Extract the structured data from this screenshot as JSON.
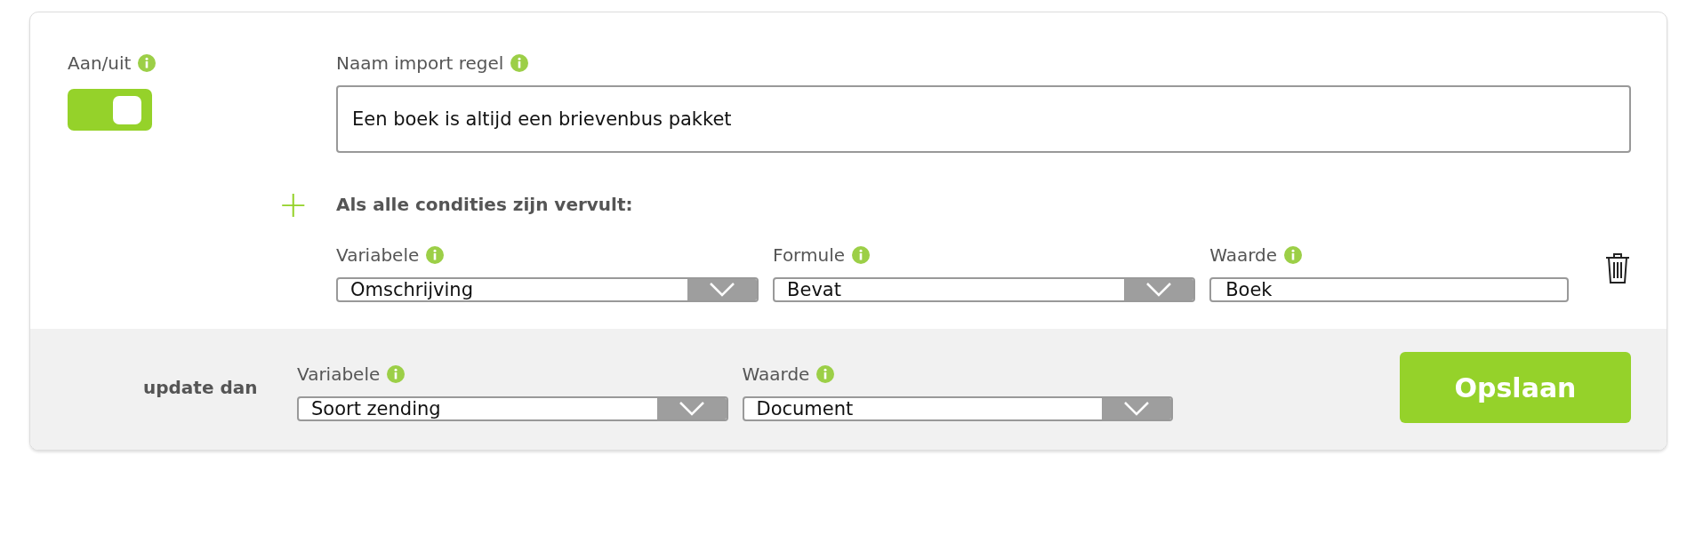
{
  "toggle": {
    "label": "Aan/uit",
    "on": true
  },
  "name_field": {
    "label": "Naam import regel",
    "value": "Een boek is altijd een brievenbus pakket"
  },
  "conditions_heading": "Als alle condities zijn vervult:",
  "add_icon": "+",
  "condition_fields": [
    {
      "label": "Variabele",
      "value": "Omschrijving",
      "kind": "select"
    },
    {
      "label": "Formule",
      "value": "Bevat",
      "kind": "select"
    },
    {
      "label": "Waarde",
      "value": "Boek",
      "kind": "text"
    }
  ],
  "update": {
    "label": "update dan",
    "fields": [
      {
        "label": "Variabele",
        "value": "Soort zending",
        "kind": "select"
      },
      {
        "label": "Waarde",
        "value": "Document",
        "kind": "select"
      }
    ]
  },
  "save_button": "Opslaan"
}
